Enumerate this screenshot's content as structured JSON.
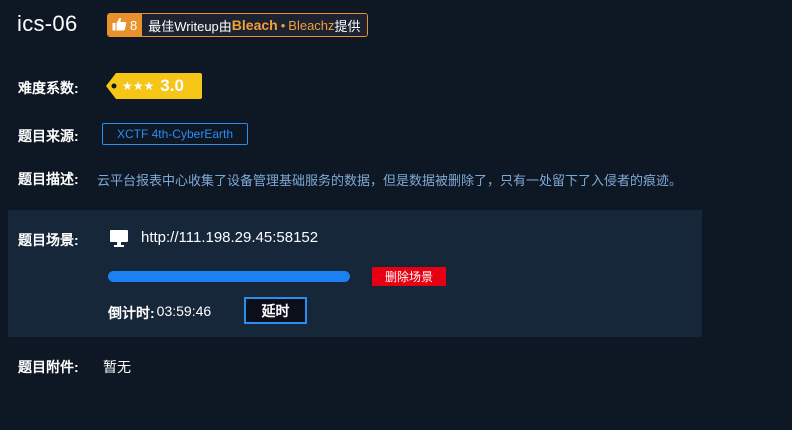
{
  "challenge": {
    "title": "ics-06"
  },
  "writeup_badge": {
    "icon": "thumbs-up-icon",
    "count": "8",
    "prefix": "最佳Writeup由",
    "author": "Bleach",
    "separator": "•",
    "team": "Bleachz",
    "suffix": "提供",
    "color": "#e8912d"
  },
  "difficulty": {
    "label": "难度系数:",
    "stars_text": "★★★",
    "score": "3.0",
    "tag_color": "#f5c518"
  },
  "source": {
    "label": "题目来源:",
    "value": "XCTF 4th-CyberEarth",
    "color": "#2d8cf0"
  },
  "description": {
    "label": "题目描述:",
    "text": "云平台报表中心收集了设备管理基础服务的数据，但是数据被删除了，只有一处留下了入侵者的痕迹。"
  },
  "scene": {
    "label": "题目场景:",
    "icon": "monitor-icon",
    "url": "http://111.198.29.45:58152",
    "progress": 1.0,
    "delete_label": "删除场景",
    "countdown_label": "倒计时:",
    "countdown_value": "03:59:46",
    "extend_label": "延时",
    "delete_color": "#e60012",
    "progress_color": "#1b80f2"
  },
  "attachment": {
    "label": "题目附件:",
    "value": "暂无"
  }
}
